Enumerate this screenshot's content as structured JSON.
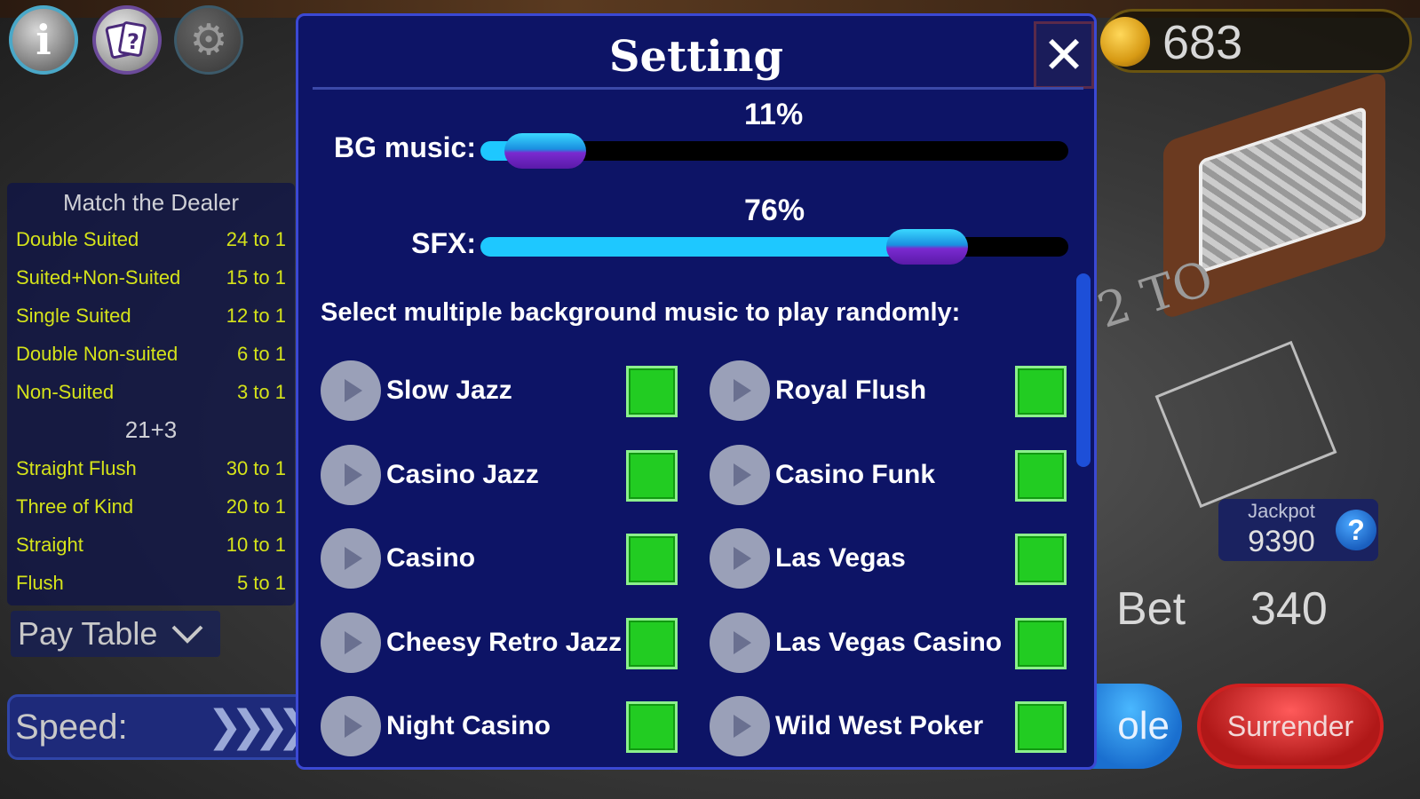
{
  "hud": {
    "info_label": "i",
    "coins": "683",
    "jackpot_label": "Jackpot",
    "jackpot_value": "9390",
    "jackpot_help": "?",
    "bet_label": "Bet",
    "bet_value": "340",
    "double_label": "ole",
    "surrender_label": "Surrender",
    "speed_label": "Speed:",
    "speed_arrows": "❯❯❯❯",
    "paytable_toggle": "Pay Table",
    "table_text": "2 TO"
  },
  "paytable": {
    "title": "Match the Dealer",
    "match_rows": [
      {
        "name": "Double Suited",
        "payout": "24 to 1"
      },
      {
        "name": "Suited+Non-Suited",
        "payout": "15 to 1"
      },
      {
        "name": "Single Suited",
        "payout": "12 to 1"
      },
      {
        "name": "Double Non-suited",
        "payout": "6 to 1"
      },
      {
        "name": "Non-Suited",
        "payout": "3 to 1"
      }
    ],
    "subtitle": "21+3",
    "side_rows": [
      {
        "name": "Straight Flush",
        "payout": "30 to 1"
      },
      {
        "name": "Three of Kind",
        "payout": "20 to 1"
      },
      {
        "name": "Straight",
        "payout": "10 to 1"
      },
      {
        "name": "Flush",
        "payout": "5 to 1"
      }
    ]
  },
  "settings": {
    "title": "Setting",
    "close_icon": "✕",
    "bg_music": {
      "label": "BG music:",
      "percent_text": "11%",
      "value": 0.11
    },
    "sfx": {
      "label": "SFX:",
      "percent_text": "76%",
      "value": 0.76
    },
    "prompt": "Select multiple background music to play randomly:",
    "tracks_left": [
      {
        "name": "Slow Jazz",
        "checked": true
      },
      {
        "name": "Casino Jazz",
        "checked": true
      },
      {
        "name": "Casino",
        "checked": true
      },
      {
        "name": "Cheesy Retro Jazz",
        "checked": true
      },
      {
        "name": "Night Casino",
        "checked": true
      }
    ],
    "tracks_right": [
      {
        "name": "Royal Flush",
        "checked": true
      },
      {
        "name": "Casino Funk",
        "checked": true
      },
      {
        "name": "Las Vegas",
        "checked": true
      },
      {
        "name": "Las Vegas Casino",
        "checked": true
      },
      {
        "name": "Wild West Poker",
        "checked": true
      }
    ]
  },
  "colors": {
    "modal_bg": "#0d1466",
    "slider_fill": "#1ec8ff",
    "checkbox": "#22cc22",
    "paytable_text": "#d5e31a"
  }
}
